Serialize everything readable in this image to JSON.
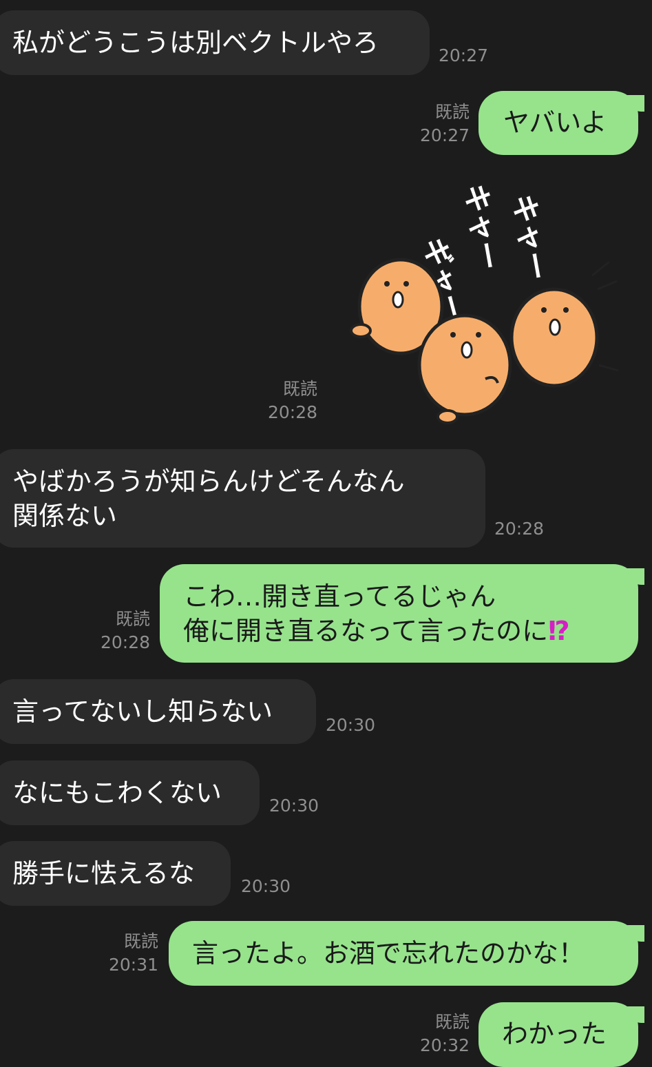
{
  "read_label": "既読",
  "messages": [
    {
      "text": "私がどうこうは別ベクトルやろ",
      "time": "20:27"
    },
    {
      "text": "ヤバいよ",
      "time": "20:27"
    },
    {
      "time": "20:28"
    },
    {
      "lines": [
        "やばかろうが知らんけどそんなん",
        "関係ない"
      ],
      "time": "20:28"
    },
    {
      "line1": "こわ…開き直ってるじゃん",
      "line2": "俺に開き直るなって言ったのに",
      "emphasis": "⁉",
      "time": "20:28"
    },
    {
      "text": "言ってないし知らない",
      "time": "20:30"
    },
    {
      "text": "なにもこわくない",
      "time": "20:30"
    },
    {
      "text": "勝手に怯えるな",
      "time": "20:30"
    },
    {
      "text": "言ったよ。お酒で忘れたのかな！",
      "time": "20:31"
    },
    {
      "text": "わかった",
      "time": "20:32"
    }
  ],
  "sticker": {
    "text1": "ギャー",
    "text2": "キャー",
    "text3": "キャー",
    "body_color": "#f6ad6b",
    "outline_color": "#222222"
  },
  "colors": {
    "background": "#1c1c1c",
    "incoming_bubble": "#2b2b2b",
    "outgoing_bubble": "#96e38c",
    "meta_text": "#8f8f8f",
    "emphasis": "#d61fc6"
  }
}
